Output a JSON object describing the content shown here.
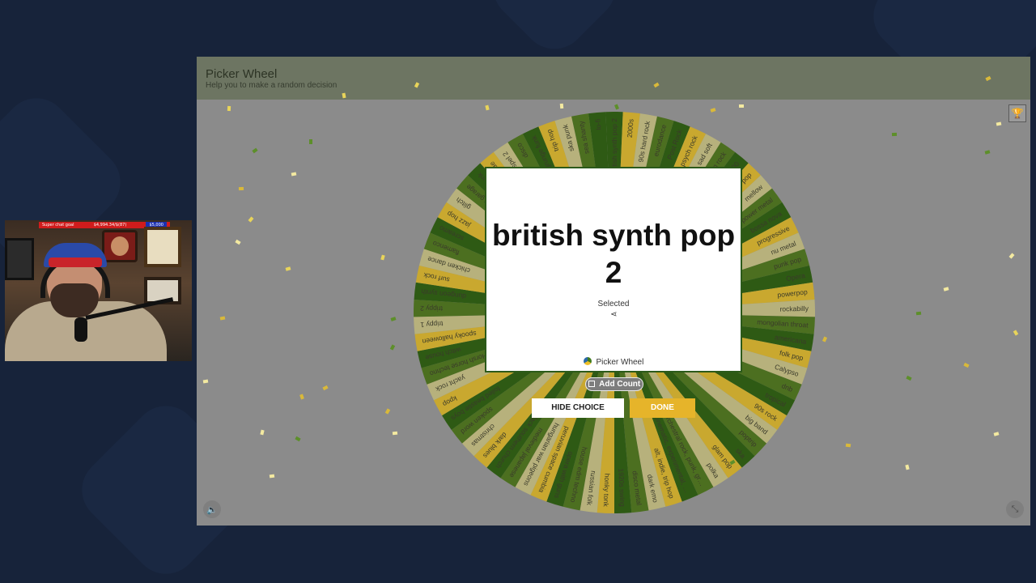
{
  "webcam": {
    "goal_label": "Super chat goal",
    "goal_progress": "$4,994.34/$(87)",
    "goal_total": "$5,000"
  },
  "app": {
    "title": "Picker Wheel",
    "subtitle": "Help you to make a random decision"
  },
  "wheel": {
    "colors": [
      "#2e5a14",
      "#c9a82f",
      "#b7b17c",
      "#4c6f20"
    ],
    "segments": [
      "british synth pop 2",
      "2000s",
      "90s hard rock",
      "eurodance",
      "Post Rock",
      "psych rock",
      "sad soft",
      "glam rock",
      "big band 100",
      "pop",
      "mellow",
      "power metal",
      "bossa nova",
      "progressive",
      "nu metal",
      "punk pop",
      "Opera",
      "powerpop",
      "rockabilly",
      "mongolian throat",
      "americana",
      "folk pop",
      "Calypso",
      "dnb",
      "tropical",
      "90s rock",
      "big band",
      "poptrip",
      "ska",
      "glam pop",
      "polka",
      "orchestral rock, punk, grunge",
      "cinematic, experimental, electronic",
      "alt, indie, trip hop",
      "dark emo",
      "disco metal",
      "1920s swing",
      "honky tonk",
      "russian folk",
      "house edm techno",
      "opera with guns",
      "peruvian space cumbia",
      "hungarian war pigeons",
      "medieval japanese",
      "black southern church",
      "dark blues",
      "christmas",
      "spoken word",
      "foiled beastie boys",
      "kpop",
      "yacht rock",
      "Horsh horse techno",
      "witch house",
      "spooky halloween",
      "trippy 1",
      "trippy 2",
      "dungeon synth",
      "surf rock",
      "chicken dance",
      "flamenco",
      "screamo",
      "jazz hop",
      "glitch",
      "dark garage",
      "funky funk",
      "reggae",
      "gospel 2",
      "disco",
      "grunge funk",
      "trip hop",
      "ska punk",
      "sea shanty",
      "lo-fi"
    ]
  },
  "result": {
    "title_line1": "british synth pop",
    "title_line2": "2",
    "selected_label": "Selected",
    "share_icon": "share-icon",
    "brand": "Picker Wheel"
  },
  "actions": {
    "add_count": "Add Count",
    "hide_choice": "HIDE CHOICE",
    "done": "DONE"
  },
  "icons": {
    "trophy": "trophy-icon",
    "sound": "sound-icon",
    "fullscreen": "collapse-icon"
  }
}
